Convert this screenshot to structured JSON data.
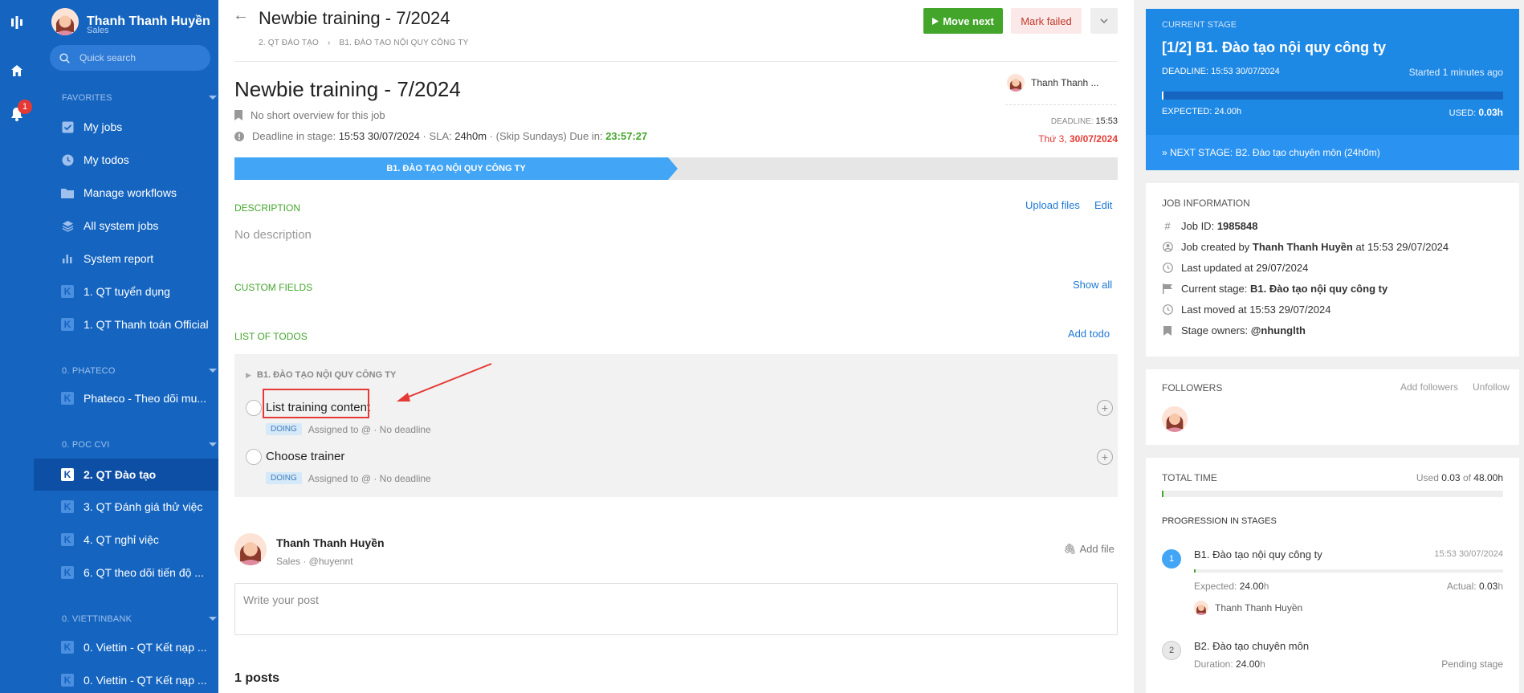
{
  "user": {
    "name": "Thanh Thanh Huyền",
    "role": "Sales"
  },
  "notifications": {
    "count": "1"
  },
  "search": {
    "placeholder": "Quick search"
  },
  "sidebar": {
    "favorites_title": "FAVORITES",
    "favorites": [
      {
        "label": "My jobs",
        "icon": "checkbox-icon"
      },
      {
        "label": "My todos",
        "icon": "clock-icon"
      },
      {
        "label": "Manage workflows",
        "icon": "folder-icon"
      },
      {
        "label": "All system jobs",
        "icon": "layers-icon"
      },
      {
        "label": "System report",
        "icon": "bar-chart-icon"
      },
      {
        "label": "1. QT tuyển dụng",
        "icon": "k-icon"
      },
      {
        "label": "1. QT Thanh toán Official",
        "icon": "k-icon"
      }
    ],
    "group1_title": "0. PHATECO",
    "group1": [
      {
        "label": "Phateco - Theo dõi mu..."
      }
    ],
    "group2_title": "0. POC CVI",
    "group2": [
      {
        "label": "2. QT Đào tạo",
        "active": true
      },
      {
        "label": "3. QT Đánh giá thử việc"
      },
      {
        "label": "4. QT nghỉ việc"
      },
      {
        "label": "6. QT theo dõi tiến độ ..."
      }
    ],
    "group3_title": "0. VIETTINBANK",
    "group3": [
      {
        "label": "0. Viettin - QT Kết nạp ..."
      },
      {
        "label": "0. Viettin - QT Kết nạp ..."
      }
    ]
  },
  "header": {
    "title": "Newbie training - 7/2024",
    "breadcrumb_1": "2. QT ĐÀO TẠO",
    "breadcrumb_sep": "›",
    "breadcrumb_2": "B1. ĐÀO TẠO NỘI QUY CÔNG TY",
    "move_next": "Move next",
    "mark_failed": "Mark failed"
  },
  "job": {
    "title": "Newbie training - 7/2024",
    "overview": "No short overview for this job",
    "deadline_prefix": "Deadline in stage:",
    "deadline_value": "15:53 30/07/2024",
    "sla_prefix": "· SLA:",
    "sla_value": "24h0m",
    "skip": "· (Skip Sundays) Due in:",
    "due_in": "23:57:27",
    "owner": "Thanh Thanh ...",
    "deadline_label": "DEADLINE:",
    "deadline_time": "15:53",
    "deadline_day": "Thứ 3,",
    "deadline_date": "30/07/2024",
    "stage_label": "B1. ĐÀO TẠO NỘI QUY CÔNG TY",
    "stage_progress": 0.5
  },
  "description": {
    "title": "DESCRIPTION",
    "upload": "Upload files",
    "edit": "Edit",
    "empty": "No description"
  },
  "custom_fields": {
    "title": "CUSTOM FIELDS",
    "show_all": "Show all"
  },
  "todos": {
    "title": "LIST OF TODOS",
    "add": "Add todo",
    "stage": "B1. ĐÀO TẠO NỘI QUY CÔNG TY",
    "items": [
      {
        "title": "List training content",
        "status": "DOING",
        "meta": "Assigned to @ · No deadline"
      },
      {
        "title": "Choose trainer",
        "status": "DOING",
        "meta": "Assigned to @ · No deadline"
      }
    ]
  },
  "post": {
    "author": "Thanh Thanh Huyền",
    "sub": "Sales · @huyennt",
    "add_file": "Add file",
    "placeholder": "Write your post",
    "count": "1 posts"
  },
  "current_stage": {
    "label": "CURRENT STAGE",
    "title": "[1/2] B1. Đào tạo nội quy công ty",
    "deadline": "DEADLINE: 15:53 30/07/2024",
    "started": "Started 1 minutes ago",
    "expected_label": "EXPECTED:",
    "expected": "24.00h",
    "used_label": "USED:",
    "used": "0.03h",
    "used_fraction": 0.00125,
    "next_prefix": "» NEXT STAGE: B2. Đào tạo chuyên môn",
    "next_dur": "(24h0m)"
  },
  "job_info": {
    "title": "JOB INFORMATION",
    "id_label": "Job ID:",
    "id": "1985848",
    "created_prefix": "Job created by",
    "created_by": "Thanh Thanh Huyền",
    "created_at": "at 15:53 29/07/2024",
    "updated": "Last updated at 29/07/2024",
    "stage_label": "Current stage:",
    "stage": "B1. Đào tạo nội quy công ty",
    "moved": "Last moved at 15:53 29/07/2024",
    "owners_label": "Stage owners:",
    "owners": "@nhunglth"
  },
  "followers": {
    "title": "FOLLOWERS",
    "add": "Add followers",
    "unfollow": "Unfollow"
  },
  "total_time": {
    "title": "TOTAL TIME",
    "used_label": "Used",
    "used": "0.03",
    "of": "of",
    "total": "48.00h",
    "fraction": 0.000625,
    "progression_title": "PROGRESSION IN STAGES",
    "stages": [
      {
        "num": "1",
        "name": "B1. Đào tạo nội quy công ty",
        "time": "15:53 30/07/2024",
        "expected_label": "Expected:",
        "expected": "24.00",
        "actual_label": "Actual:",
        "actual": "0.03",
        "unit": "h",
        "owner": "Thanh Thanh Huyền",
        "fraction": 0.00125
      },
      {
        "num": "2",
        "name": "B2. Đào tạo chuyên môn",
        "duration_label": "Duration:",
        "duration": "24.00",
        "unit": "h",
        "status": "Pending stage"
      }
    ]
  },
  "colors": {
    "primary": "#1565c0",
    "accent": "#1e88e5",
    "success": "#43a62b",
    "danger": "#e53935"
  }
}
